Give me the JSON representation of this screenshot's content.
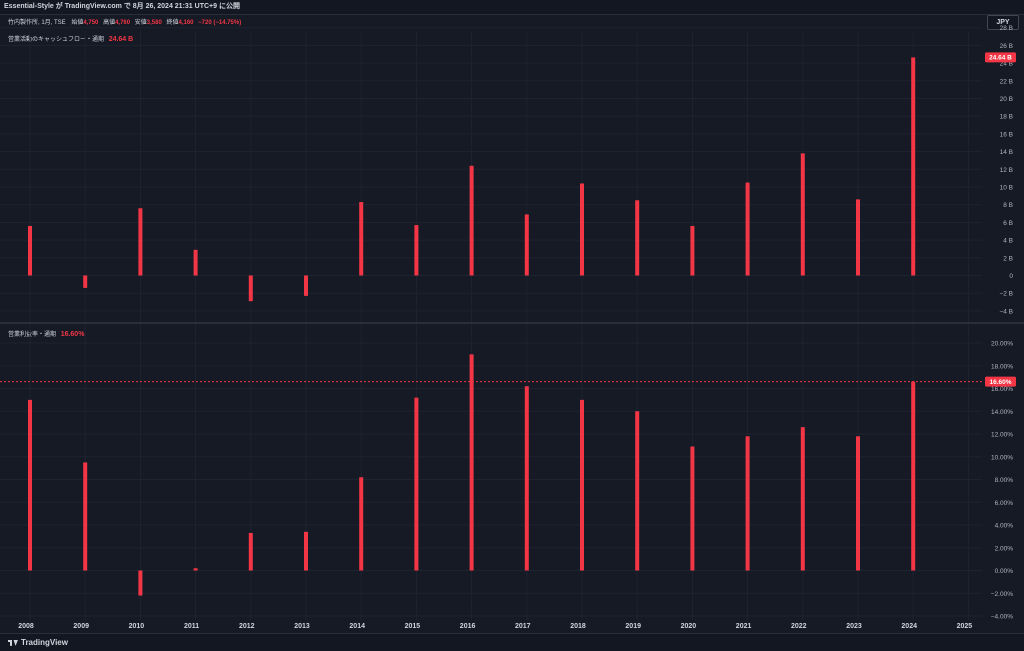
{
  "header": {
    "publisher": "Essential-Style が TradingView.com で 8月 26, 2024 21:31 UTC+9 に公開",
    "symbol": "竹内製作所, 1月, TSE",
    "open_label": "始値",
    "open_value": "4,750",
    "high_label": "高値",
    "high_value": "4,760",
    "low_label": "安値",
    "low_value": "3,580",
    "close_label": "終値",
    "close_value": "4,160",
    "change": "−720 (−14.75%)"
  },
  "currency": "JPY",
  "footer": {
    "logo_text": "TradingView"
  },
  "colors": {
    "bar": "#f23645",
    "background": "#161a25",
    "grid": "#1f2330",
    "text": "#b2b5be"
  },
  "chart_data": [
    {
      "type": "bar",
      "title": "営業活動のキャッシュフロー・通期",
      "last_value_label": "24.64 B",
      "categories": [
        "2008",
        "2009",
        "2010",
        "2011",
        "2012",
        "2013",
        "2014",
        "2015",
        "2016",
        "2017",
        "2018",
        "2019",
        "2020",
        "2021",
        "2022",
        "2023",
        "2024"
      ],
      "values": [
        5.6,
        -1.4,
        7.6,
        2.9,
        -2.9,
        -2.3,
        8.3,
        5.7,
        12.4,
        6.9,
        10.4,
        8.5,
        5.6,
        10.5,
        13.8,
        8.6,
        24.64
      ],
      "unit": "B",
      "ylim": [
        -4,
        28
      ],
      "y_ticks": [
        "−4 B",
        "−2 B",
        "0",
        "2 B",
        "4 B",
        "6 B",
        "8 B",
        "10 B",
        "12 B",
        "14 B",
        "16 B",
        "18 B",
        "20 B",
        "22 B",
        "24 B",
        "26 B",
        "28 B"
      ],
      "y_tick_values": [
        -4,
        -2,
        0,
        2,
        4,
        6,
        8,
        10,
        12,
        14,
        16,
        18,
        20,
        22,
        24,
        26,
        28
      ]
    },
    {
      "type": "bar",
      "title": "営業利益率・通期",
      "last_value_label": "16.60%",
      "categories": [
        "2008",
        "2009",
        "2010",
        "2011",
        "2012",
        "2013",
        "2014",
        "2015",
        "2016",
        "2017",
        "2018",
        "2019",
        "2020",
        "2021",
        "2022",
        "2023",
        "2024"
      ],
      "values": [
        15.0,
        9.5,
        -2.2,
        0.2,
        3.3,
        3.4,
        8.2,
        15.2,
        19.0,
        16.2,
        15.0,
        14.0,
        10.9,
        11.8,
        12.6,
        11.8,
        16.6
      ],
      "unit": "%",
      "ylim": [
        -4,
        20
      ],
      "y_ticks": [
        "−4.00%",
        "−2.00%",
        "0.00%",
        "2.00%",
        "4.00%",
        "6.00%",
        "8.00%",
        "10.00%",
        "12.00%",
        "14.00%",
        "16.00%",
        "18.00%",
        "20.00%"
      ],
      "y_tick_values": [
        -4,
        -2,
        0,
        2,
        4,
        6,
        8,
        10,
        12,
        14,
        16,
        18,
        20
      ],
      "reference_line": 16.6
    }
  ],
  "x_axis_labels": [
    "2008",
    "2009",
    "2010",
    "2011",
    "2012",
    "2013",
    "2014",
    "2015",
    "2016",
    "2017",
    "2018",
    "2019",
    "2020",
    "2021",
    "2022",
    "2023",
    "2024",
    "2025"
  ]
}
